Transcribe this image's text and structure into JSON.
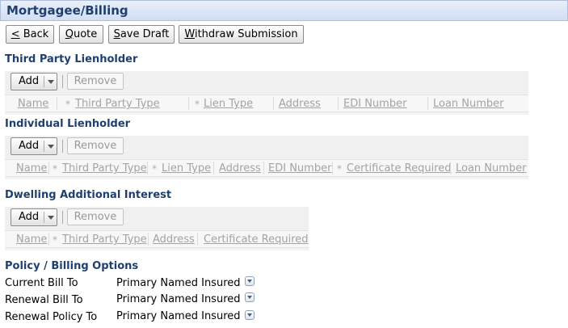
{
  "page": {
    "title": "Mortgagee/Billing"
  },
  "toolbar": {
    "back": {
      "mnemonic": "<",
      "rest": " Back"
    },
    "quote": {
      "mnemonic": "Q",
      "rest": "uote"
    },
    "save_draft": {
      "mnemonic": "S",
      "rest": "ave Draft"
    },
    "withdraw": {
      "mnemonic": "W",
      "rest": "ithdraw Submission"
    }
  },
  "sections": {
    "third_party": {
      "title": "Third Party Lienholder",
      "add_label": "Add",
      "remove_label": "Remove",
      "columns": [
        "Name",
        "Third Party Type",
        "Lien Type",
        "Address",
        "EDI Number",
        "Loan Number"
      ]
    },
    "individual": {
      "title": "Individual Lienholder",
      "add_label": "Add",
      "remove_label": "Remove",
      "columns": [
        "Name",
        "Third Party Type",
        "Lien Type",
        "Address",
        "EDI Number",
        "Certificate Required",
        "Loan Number"
      ]
    },
    "dwelling": {
      "title": "Dwelling Additional Interest",
      "add_label": "Add",
      "remove_label": "Remove",
      "columns": [
        "Name",
        "Third Party Type",
        "Address",
        "Certificate Required"
      ]
    }
  },
  "required_marker": "*",
  "billing": {
    "title": "Policy / Billing Options",
    "rows": [
      {
        "label": "Current Bill To",
        "value": "Primary Named Insured"
      },
      {
        "label": "Renewal Bill To",
        "value": "Primary Named Insured"
      },
      {
        "label": "Renewal Policy To",
        "value": "Primary Named Insured"
      }
    ]
  }
}
